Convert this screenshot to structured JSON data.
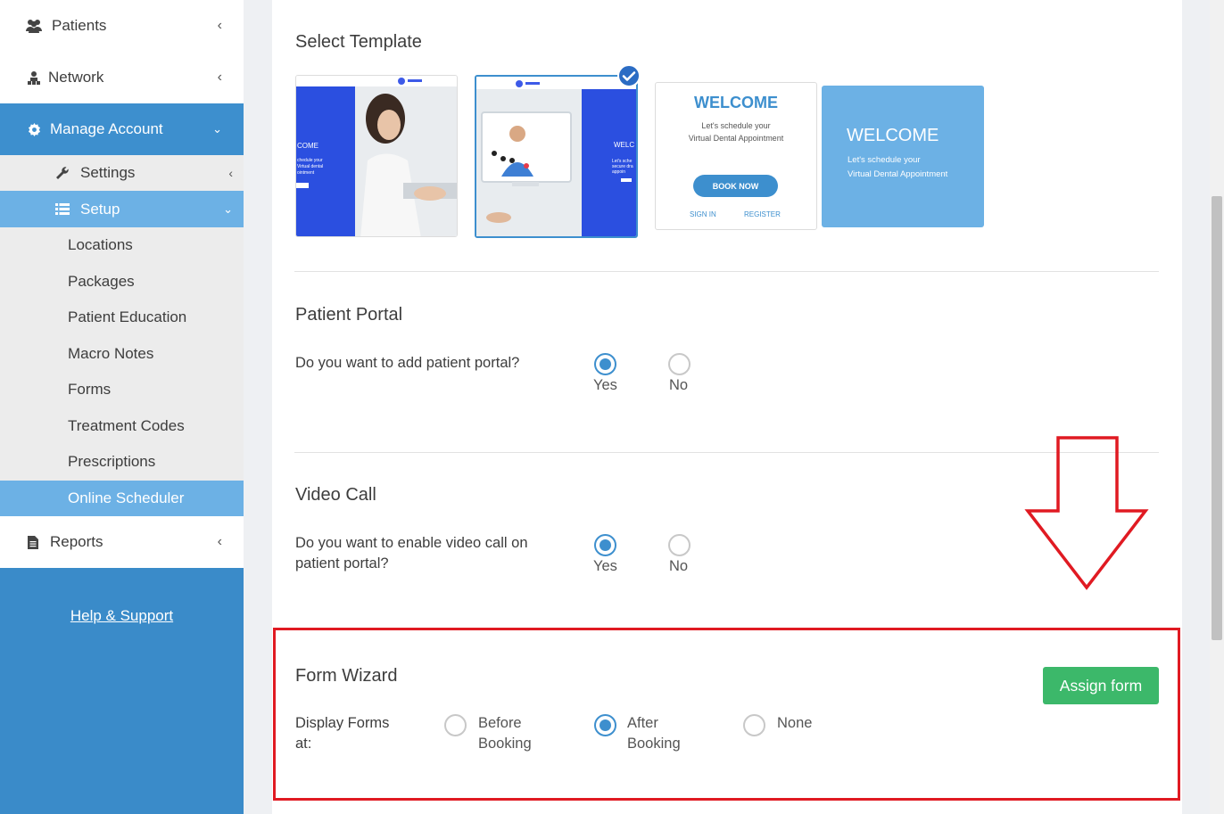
{
  "sidebar": {
    "patients": "Patients",
    "network": "Network",
    "manage_account": "Manage Account",
    "settings": "Settings",
    "setup": "Setup",
    "setup_items": [
      "Locations",
      "Packages",
      "Patient Education",
      "Macro Notes",
      "Forms",
      "Treatment Codes",
      "Prescriptions",
      "Online Scheduler"
    ],
    "reports": "Reports",
    "help": "Help & Support"
  },
  "template_section": {
    "title": "Select Template",
    "selected_index": 1,
    "tpl1": {
      "heading": "COME",
      "lines": [
        "chedule your",
        "Virtual dental",
        "ointment"
      ]
    },
    "tpl2": {
      "heading": "WELC",
      "lines": [
        "Let's sche",
        "secure dra",
        "appoin"
      ]
    },
    "tpl3": {
      "welcome": "WELCOME",
      "line1": "Let's schedule your",
      "line2": "Virtual Dental Appointment",
      "book": "BOOK NOW",
      "sign_in": "SIGN IN",
      "register": "REGISTER"
    },
    "tpl4": {
      "welcome": "WELCOME",
      "line1": "Let's schedule your",
      "line2": "Virtual Dental Appointment"
    }
  },
  "patient_portal": {
    "title": "Patient Portal",
    "question": "Do you want to add patient portal?",
    "yes": "Yes",
    "no": "No",
    "selected": "Yes"
  },
  "video_call": {
    "title": "Video Call",
    "question_line1": "Do you want to enable video call on",
    "question_line2": "patient portal?",
    "yes": "Yes",
    "no": "No",
    "selected": "Yes"
  },
  "form_wizard": {
    "title": "Form Wizard",
    "label_line1": "Display Forms",
    "label_line2": "at:",
    "before_line1": "Before",
    "before_line2": "Booking",
    "after_line1": "After",
    "after_line2": "Booking",
    "none": "None",
    "selected": "After Booking",
    "assign_button": "Assign form"
  },
  "colors": {
    "primary": "#3d8fce",
    "light_blue": "#6cb1e5",
    "green": "#3cb86a",
    "annotation_red": "#e01a22"
  }
}
